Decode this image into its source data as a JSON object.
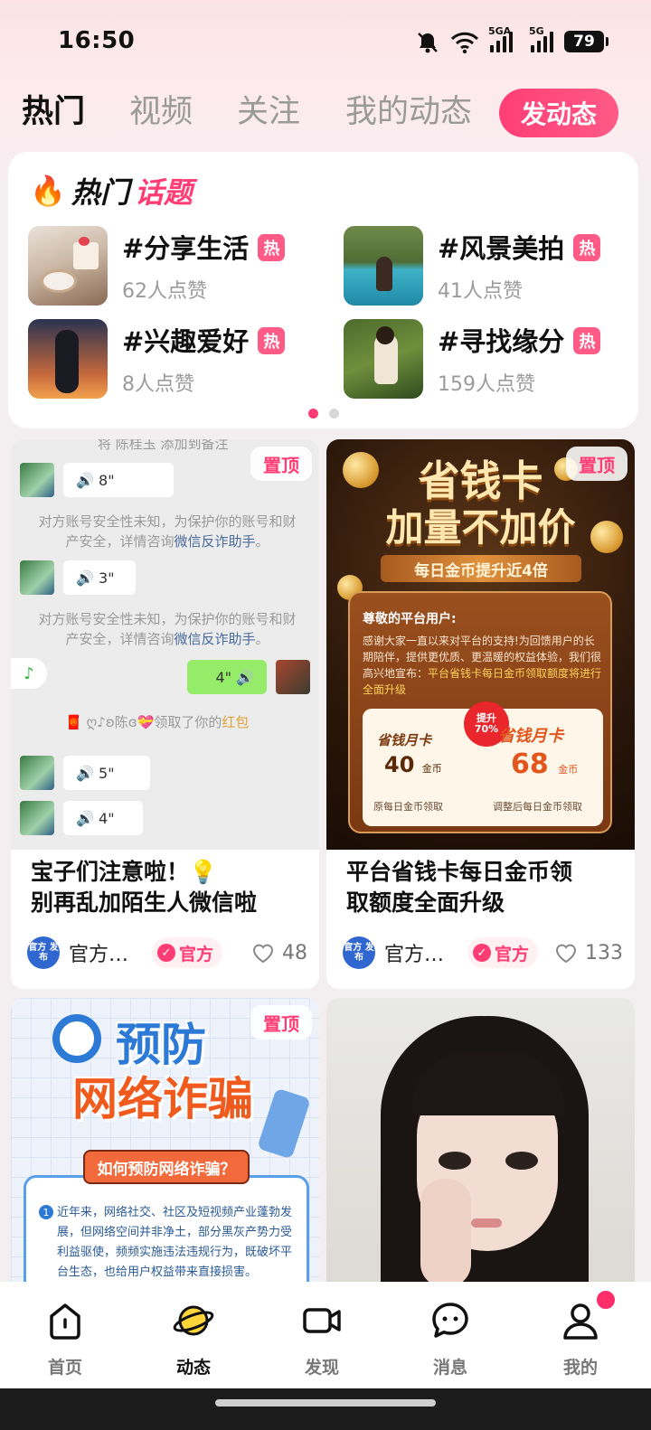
{
  "status_bar": {
    "time": "16:50",
    "network_1": "5GA",
    "network_2": "5G",
    "battery": "79"
  },
  "tabs": [
    {
      "label": "热门",
      "active": true
    },
    {
      "label": "视频",
      "active": false
    },
    {
      "label": "关注",
      "active": false
    },
    {
      "label": "我的动态",
      "active": false
    }
  ],
  "post_button": "发动态",
  "hot_topics": {
    "title_part1": "热门",
    "title_part2": "话题",
    "hot_badge": "热",
    "items": [
      {
        "name": "#分享生活",
        "likes": "62人点赞"
      },
      {
        "name": "#风景美拍",
        "likes": "41人点赞"
      },
      {
        "name": "#兴趣爱好",
        "likes": "8人点赞"
      },
      {
        "name": "#寻找缘分",
        "likes": "159人点赞"
      }
    ],
    "page_dots": 2,
    "active_dot": 0
  },
  "feed": [
    {
      "pinned_label": "置顶",
      "title_line1": "宝子们注意啦！💡",
      "title_line2": "别再乱加陌生人微信啦",
      "author": "官方…",
      "avatar_text": "官方 发布",
      "badge": "官方",
      "likes": "48",
      "chat": {
        "top_cut": "将    陈桂玉    添加到备注",
        "voice_1": "8\"",
        "notice_text": "对方账号安全性未知，为保护你的账号和财产安全，详情咨询",
        "notice_link": "微信反诈助手",
        "notice_end": "。",
        "voice_2": "3\"",
        "mine_voice": "4\"",
        "redpack_text": "ღ♪ʚ陈ɞ💝领取了你的",
        "redpack_link": "红包",
        "voice_3": "5\"",
        "voice_4": "4\""
      }
    },
    {
      "pinned_label": "置顶",
      "title_line1": "平台省钱卡每日金币领",
      "title_line2": "取额度全面升级",
      "author": "官方…",
      "avatar_text": "官方 发布",
      "badge": "官方",
      "likes": "133",
      "promo": {
        "headline1": "省钱卡",
        "headline2": "加量不加价",
        "subline": "每日金币提升近4倍",
        "greeting": "尊敬的平台用户:",
        "body": "感谢大家一直以来对平台的支持!为回馈用户的长期陪伴，提供更优质、更温暖的权益体验，我们很高兴地宣布：",
        "body_highlight": "平台省钱卡每日金币领取额度将进行全面升级",
        "left_label": "省钱月卡",
        "left_value": "40",
        "unit": "金币",
        "left_caption": "原每日金币领取",
        "burst": "提升 70%",
        "right_label": "省钱月卡",
        "right_value": "68",
        "right_caption": "调整后每日金币领取"
      }
    },
    {
      "pinned_label": "置顶",
      "fraud": {
        "line1": "预防",
        "line2": "网络诈骗",
        "question": "如何预防网络诈骗？",
        "num": "1",
        "text": "近年来，网络社交、社区及短视频产业蓬勃发展，但网络空间并非净土，部分黑灰产势力受利益驱使，频频实施违法违规行为，既破坏平台生态，也给用户权益带来直接损害。"
      }
    },
    {
      "image": "portrait"
    }
  ],
  "bottom_nav": [
    {
      "label": "首页",
      "icon": "home-icon",
      "active": false
    },
    {
      "label": "动态",
      "icon": "planet-icon",
      "active": true
    },
    {
      "label": "发现",
      "icon": "video-camera-icon",
      "active": false
    },
    {
      "label": "消息",
      "icon": "chat-bubble-icon",
      "active": false
    },
    {
      "label": "我的",
      "icon": "user-icon",
      "active": false,
      "has_dot": true
    }
  ],
  "colors": {
    "accent": "#ff3d74",
    "nav_active": "#111111"
  }
}
